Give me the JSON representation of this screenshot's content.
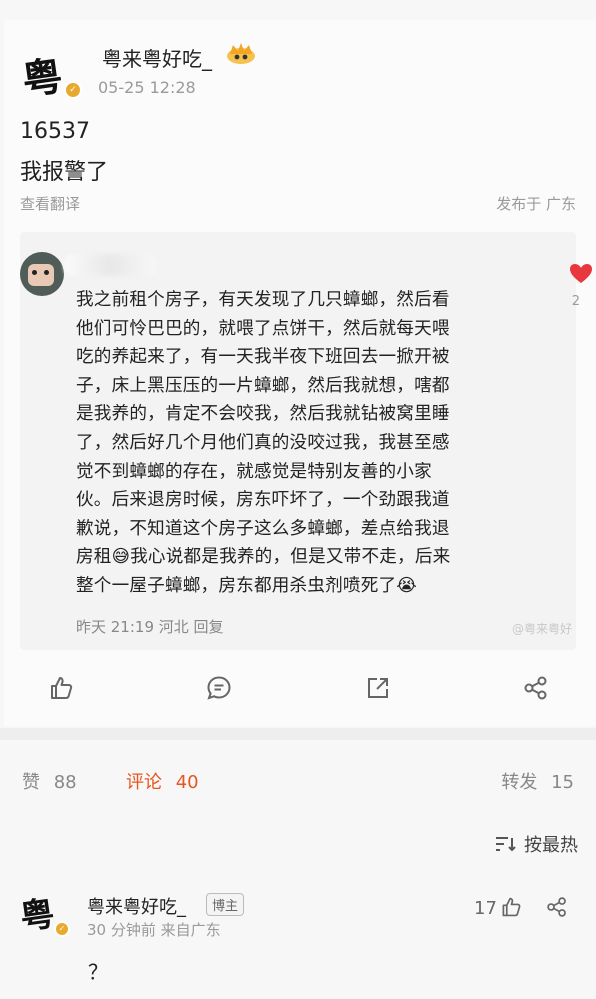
{
  "post": {
    "author": "粤来粤好吃_",
    "timestamp": "05-25 12:28",
    "content_line1": "16537",
    "content_line2": "我报警了",
    "translate_label": "查看翻译",
    "published_location": "发布于 广东"
  },
  "quoted_comment": {
    "text": "我之前租个房子，有天发现了几只蟑螂，然后看他们可怜巴巴的，就喂了点饼干，然后就每天喂吃的养起来了，有一天我半夜下班回去一掀开被子，床上黑压压的一片蟑螂，然后我就想，嗐都是我养的，肯定不会咬我，然后我就钻被窝里睡了，然后好几个月他们真的没咬过我，我甚至感觉不到蟑螂的存在，就感觉是特别友善的小家伙。后来退房时候，房东吓坏了，一个劲跟我道歉说，不知道这个房子这么多蟑螂，差点给我退房租😅我心说都是我养的，但是又带不走，后来整个一屋子蟑螂，房东都用杀虫剂喷死了😭",
    "lines": [
      "我之前租个房子，有天发现了几只蟑螂，然后看",
      "他们可怜巴巴的，就喂了点饼干，然后就每天喂",
      "吃的养起来了，有一天我半夜下班回去一掀开被",
      "子，床上黑压压的一片蟑螂，然后我就想，嗐都",
      "是我养的，肯定不会咬我，然后我就钻被窝里睡",
      "了，然后好几个月他们真的没咬过我，我甚至感",
      "觉不到蟑螂的存在，就感觉是特别友善的小家",
      "伙。后来退房时候，房东吓坏了，一个劲跟我道",
      "歉说，不知道这个房子这么多蟑螂，差点给我退",
      "房租😅我心说都是我养的，但是又带不走，后来",
      "整个一屋子蟑螂，房东都用杀虫剂喷死了😭"
    ],
    "meta": "昨天 21:19 河北 回复",
    "likes_partial": "2",
    "watermark": "@粤来粤好"
  },
  "stats": {
    "likes_label": "赞",
    "likes_count": "88",
    "comments_label": "评论",
    "comments_count": "40",
    "reposts_label": "转发",
    "reposts_count": "15",
    "sort_label": "按最热"
  },
  "reply": {
    "author": "粤来粤好吃_",
    "badge": "博主",
    "time_location": "30 分钟前  来自广东",
    "likes": "17",
    "text": "？"
  },
  "colors": {
    "accent": "#e8551f",
    "gold": "#e8a92f",
    "heart": "#e8383d"
  }
}
